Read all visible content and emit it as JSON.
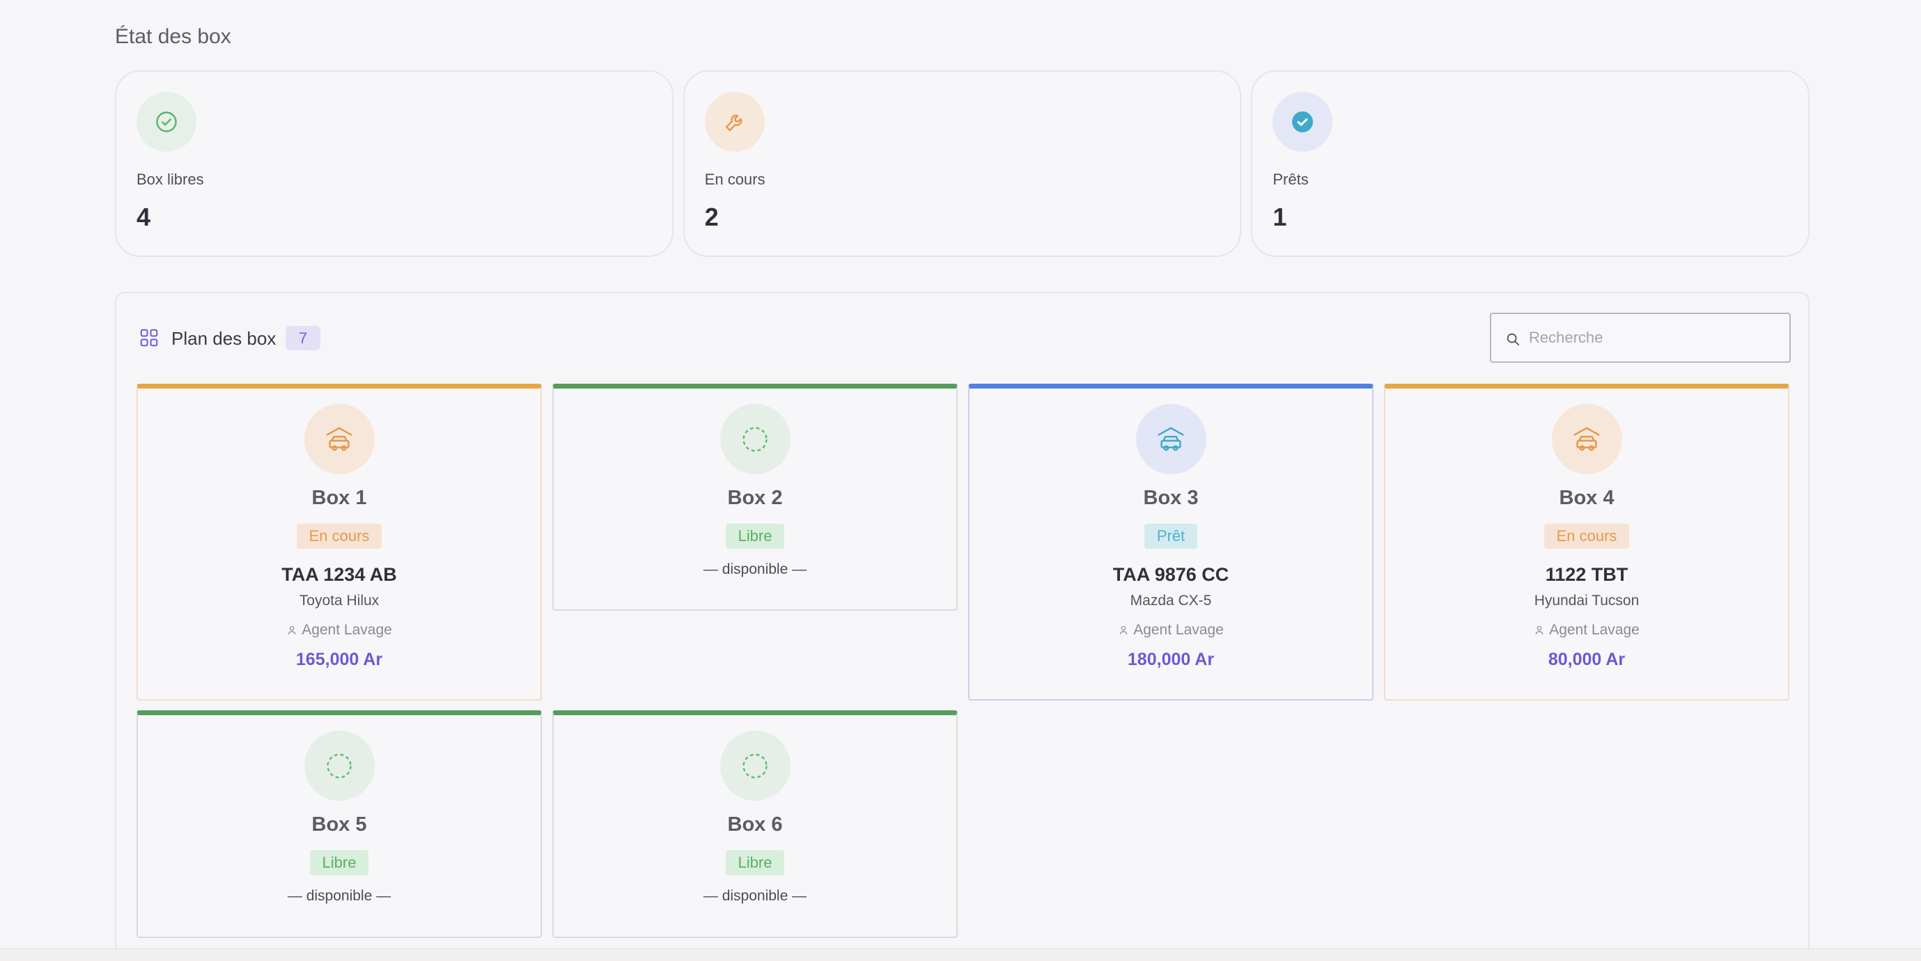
{
  "page_title": "État des box",
  "stats": [
    {
      "label": "Box libres",
      "value": "4",
      "icon": "check-circle-icon",
      "bg": "#e6f0e8",
      "color": "#53b46a"
    },
    {
      "label": "En cours",
      "value": "2",
      "icon": "wrench-icon",
      "bg": "#f6e8da",
      "color": "#e4994c"
    },
    {
      "label": "Prêts",
      "value": "1",
      "icon": "check-badge-icon",
      "bg": "#e3e7f6",
      "color": "#3ea9c8"
    }
  ],
  "plan": {
    "title": "Plan des box",
    "count": "7",
    "search_placeholder": "Recherche"
  },
  "boxes": [
    {
      "name": "Box 1",
      "status": "En cours",
      "plate": "TAA 1234 AB",
      "model": "Toyota Hilux",
      "agent": "Agent Lavage",
      "price": "165,000 Ar",
      "icon": "car-garage-icon",
      "theme": "orange"
    },
    {
      "name": "Box 2",
      "status": "Libre",
      "available": "— disponible —",
      "icon": "empty-circle-icon",
      "theme": "green"
    },
    {
      "name": "Box 3",
      "status": "Prêt",
      "plate": "TAA 9876 CC",
      "model": "Mazda CX-5",
      "agent": "Agent Lavage",
      "price": "180,000 Ar",
      "icon": "car-garage-icon",
      "theme": "blue"
    },
    {
      "name": "Box 4",
      "status": "En cours",
      "plate": "1122 TBT",
      "model": "Hyundai Tucson",
      "agent": "Agent Lavage",
      "price": "80,000 Ar",
      "icon": "car-garage-icon",
      "theme": "orange"
    },
    {
      "name": "Box 5",
      "status": "Libre",
      "available": "— disponible —",
      "icon": "empty-circle-icon",
      "theme": "green"
    },
    {
      "name": "Box 6",
      "status": "Libre",
      "available": "— disponible —",
      "icon": "empty-circle-icon",
      "theme": "green"
    }
  ]
}
